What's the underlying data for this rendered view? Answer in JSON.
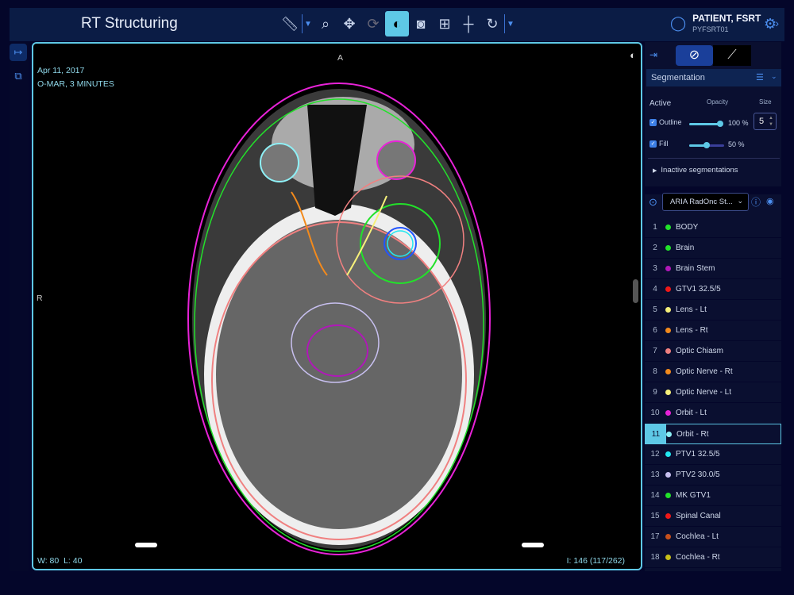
{
  "app": {
    "title": "RT Structuring"
  },
  "toolbar": {
    "tools": [
      "ruler",
      "zoom",
      "pan",
      "rotate-3d",
      "window-level",
      "snapshot",
      "layout-settings",
      "crosshair",
      "reset"
    ]
  },
  "patient": {
    "name": "PATIENT, FSRT",
    "id": "PYFSRT01"
  },
  "viewer": {
    "date": "Apr 11, 2017",
    "series": "O-MAR, 3 MINUTES",
    "orientation_top": "A",
    "orientation_left": "R",
    "window_level": "W: 80  L: 40",
    "image_index": "I: 146 (117/262)"
  },
  "segmentation": {
    "title": "Segmentation",
    "active_label": "Active",
    "opacity_label": "Opacity",
    "size_label": "Size",
    "outline_label": "Outline",
    "outline_opacity": "100 %",
    "outline_opacity_value": 100,
    "fill_label": "Fill",
    "fill_opacity": "50 %",
    "fill_opacity_value": 50,
    "size_value": "5",
    "inactive_label": "Inactive segmentations",
    "structure_set": "ARIA RadOnc St..."
  },
  "structures": [
    {
      "num": "1",
      "name": "BODY",
      "color": "#22e22a"
    },
    {
      "num": "2",
      "name": "Brain",
      "color": "#22e22a"
    },
    {
      "num": "3",
      "name": "Brain Stem",
      "color": "#b018b8"
    },
    {
      "num": "4",
      "name": "GTV1 32.5/5",
      "color": "#f01818"
    },
    {
      "num": "5",
      "name": "Lens - Lt",
      "color": "#f6f07a"
    },
    {
      "num": "6",
      "name": "Lens - Rt",
      "color": "#f38a1c"
    },
    {
      "num": "7",
      "name": "Optic Chiasm",
      "color": "#f08080"
    },
    {
      "num": "8",
      "name": "Optic Nerve - Rt",
      "color": "#f38a1c"
    },
    {
      "num": "9",
      "name": "Optic Nerve - Lt",
      "color": "#f6f07a"
    },
    {
      "num": "10",
      "name": "Orbit - Lt",
      "color": "#e822d8"
    },
    {
      "num": "11",
      "name": "Orbit - Rt",
      "color": "#8ef0f6",
      "selected": true
    },
    {
      "num": "12",
      "name": "PTV1 32.5/5",
      "color": "#22e8f0"
    },
    {
      "num": "13",
      "name": "PTV2 30.0/5",
      "color": "#c8c0f0"
    },
    {
      "num": "14",
      "name": "MK GTV1",
      "color": "#22e22a"
    },
    {
      "num": "15",
      "name": "Spinal Canal",
      "color": "#f01818"
    },
    {
      "num": "17",
      "name": "Cochlea - Lt",
      "color": "#c8501c"
    },
    {
      "num": "18",
      "name": "Cochlea - Rt",
      "color": "#c8c018"
    }
  ]
}
